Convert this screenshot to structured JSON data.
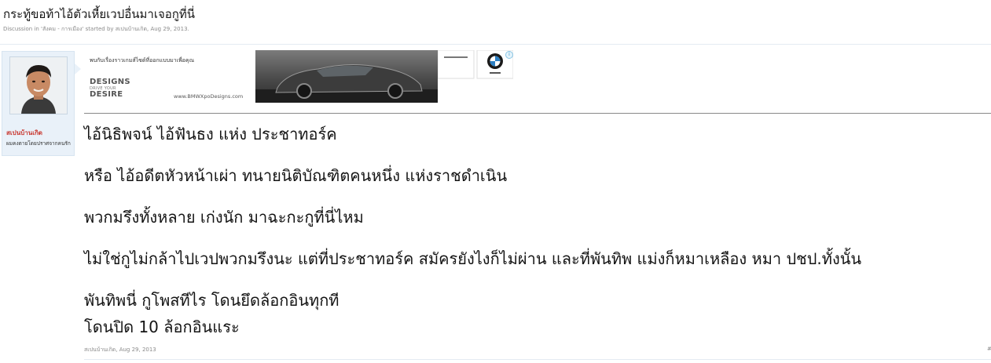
{
  "thread": {
    "title": "กระทู้ขอท้าไอ้ตัวเหี้ยเวปอื่นมาเจอกูที่นี่",
    "meta_prefix": "Discussion in '",
    "forum": "สังคม - การเมือง",
    "meta_middle": "' started by ",
    "author": "สเปนบ้านเกิด",
    "meta_sep": ", ",
    "date": "Aug 29, 2013",
    "meta_end": "."
  },
  "user": {
    "name": "สเปนบ้านเกิด",
    "title": "ผมคงตายโดยปราศจากคนรัก"
  },
  "ad": {
    "tagline": "พบกับเรื่องราวเกมส์ไซด์ที่ออกแบบมาเพื่อคุณ",
    "logo_line1": "DESIGNS",
    "logo_line2": "DRIVE YOUR",
    "logo_line3": "DESIRE",
    "url": "www.BMWXpoDesigns.com",
    "choices_icon": "adchoices-icon",
    "choices_glyph": "i"
  },
  "post": {
    "lines": [
      "ไอ้นิธิพจน์ ไอ้ฟันธง แห่ง ประชาทอร์ค",
      "หรือ ไอ้อดีตหัวหน้าเผ่า ทนายนิติบัณฑิตคนหนึ่ง แห่งราชดำเนิน",
      "พวกมรึงทั้งหลาย เก่งนัก มาฉะกะกูที่นี่ไหม",
      "ไม่ใช่กูไม่กล้าไปเวปพวกมรึงนะ แต่ที่ประชาทอร์ค สมัครยังไงก็ไม่ผ่าน และที่พันทิพ แม่งก็หมาเหลือง หมา ปชป.ทั้งนั้น",
      "พันทิพนี่ กูโพสทีไร โดนยึดล้อกอินทุกที",
      "โดนปิด 10 ล้อกอินแระ"
    ],
    "footer_author": "สเปนบ้านเกิด",
    "footer_sep": ", ",
    "footer_date": "Aug 29, 2013",
    "footer_right": "#"
  }
}
